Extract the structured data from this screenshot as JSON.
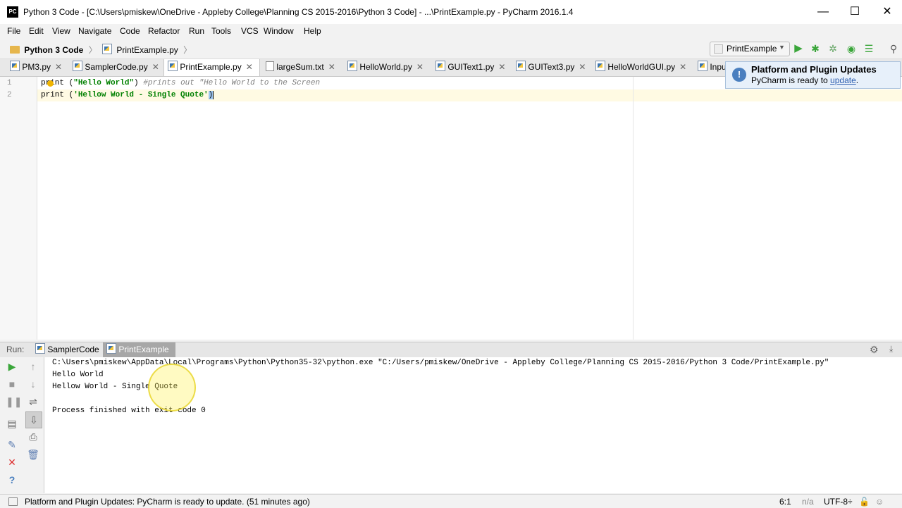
{
  "window": {
    "title": "Python 3 Code - [C:\\Users\\pmiskew\\OneDrive - Appleby College\\Planning CS 2015-2016\\Python 3 Code] - ...\\PrintExample.py - PyCharm 2016.1.4",
    "app_icon": "PC",
    "minimize": "—",
    "maximize": "☐",
    "close": "✕"
  },
  "menu": [
    "File",
    "Edit",
    "View",
    "Navigate",
    "Code",
    "Refactor",
    "Run",
    "Tools",
    "VCS",
    "Window",
    "Help"
  ],
  "breadcrumb": {
    "project": "Python 3 Code",
    "file": "PrintExample.py"
  },
  "run_config": "PrintExample",
  "tabs": [
    {
      "label": "PM3.py"
    },
    {
      "label": "SamplerCode.py"
    },
    {
      "label": "PrintExample.py"
    },
    {
      "label": "largeSum.txt"
    },
    {
      "label": "HelloWorld.py"
    },
    {
      "label": "GUIText1.py"
    },
    {
      "label": "GUIText3.py"
    },
    {
      "label": "HelloWorldGUI.py"
    },
    {
      "label": "Inpu"
    }
  ],
  "editor": {
    "line_numbers": [
      "1",
      "2"
    ],
    "line1": {
      "kw": "print",
      "paren": " (",
      "str": "\"Hello World\"",
      "close": ")",
      "comment": " #prints out \"Hello World to the Screen"
    },
    "line2": {
      "kw": "print",
      "paren": " (",
      "str": "'Hellow World - Single Quote'",
      "close": ")"
    }
  },
  "notification": {
    "title": "Platform and Plugin Updates",
    "text": "PyCharm is ready to",
    "link": "update",
    "suffix": "."
  },
  "run_panel": {
    "label": "Run:",
    "tabs": [
      "SamplerCode",
      "PrintExample"
    ],
    "console": [
      "C:\\Users\\pmiskew\\AppData\\Local\\Programs\\Python\\Python35-32\\python.exe \"C:/Users/pmiskew/OneDrive - Appleby College/Planning CS 2015-2016/Python 3 Code/PrintExample.py\"",
      "Hello World",
      "Hellow World - Single Quote",
      "",
      "Process finished with exit code 0"
    ]
  },
  "status": {
    "message": "Platform and Plugin Updates: PyCharm is ready to update. (51 minutes ago)",
    "position": "6:1",
    "na": "n/a",
    "encoding": "UTF-8÷"
  },
  "colors": {
    "string": "#008000",
    "comment": "#808080",
    "run_green": "#3aa63a"
  }
}
